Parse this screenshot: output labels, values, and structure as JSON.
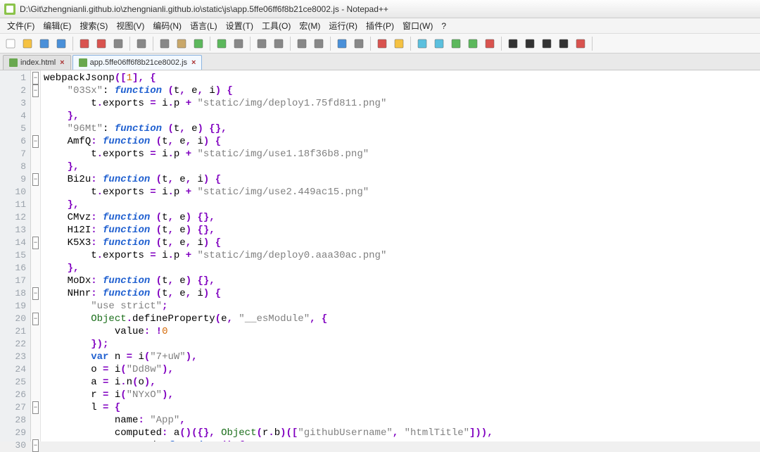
{
  "window": {
    "title": "D:\\Git\\zhengnianli.github.io\\zhengnianli.github.io\\static\\js\\app.5ffe06ff6f8b21ce8002.js - Notepad++"
  },
  "menu": {
    "items": [
      "文件(F)",
      "编辑(E)",
      "搜索(S)",
      "视图(V)",
      "编码(N)",
      "语言(L)",
      "设置(T)",
      "工具(O)",
      "宏(M)",
      "运行(R)",
      "插件(P)",
      "窗口(W)",
      "?"
    ]
  },
  "toolbar": {
    "buttons": [
      "new",
      "open",
      "save",
      "save-all",
      "close",
      "close-all",
      "print",
      "cut",
      "copy",
      "paste",
      "undo",
      "redo",
      "find",
      "replace",
      "zoom-in",
      "zoom-out",
      "sync",
      "wrap",
      "hidden",
      "indent",
      "folder",
      "doc",
      "func",
      "comment",
      "comment2",
      "rec",
      "play",
      "play-fast",
      "play-list",
      "play-next",
      "spell"
    ]
  },
  "tabs": {
    "items": [
      {
        "label": "index.html",
        "active": false
      },
      {
        "label": "app.5ffe06ff6f8b21ce8002.js",
        "active": true
      }
    ]
  },
  "code": {
    "lines": [
      {
        "n": 1,
        "fold": "minus",
        "t": [
          [
            "id",
            "webpackJsonp"
          ],
          [
            "punc",
            "(["
          ],
          [
            "num",
            "1"
          ],
          [
            "punc",
            "], {"
          ]
        ]
      },
      {
        "n": 2,
        "fold": "minus",
        "t": [
          [
            "sp",
            "    "
          ],
          [
            "str",
            "\"03Sx\""
          ],
          [
            "id",
            ": "
          ],
          [
            "fn",
            "function"
          ],
          [
            "id",
            " "
          ],
          [
            "punc",
            "("
          ],
          [
            "id",
            "t"
          ],
          [
            "punc",
            ", "
          ],
          [
            "id",
            "e"
          ],
          [
            "punc",
            ", "
          ],
          [
            "id",
            "i"
          ],
          [
            "punc",
            ") {"
          ]
        ]
      },
      {
        "n": 3,
        "t": [
          [
            "sp",
            "        "
          ],
          [
            "id",
            "t"
          ],
          [
            "punc",
            "."
          ],
          [
            "id",
            "exports "
          ],
          [
            "punc",
            "= "
          ],
          [
            "id",
            "i"
          ],
          [
            "punc",
            "."
          ],
          [
            "id",
            "p "
          ],
          [
            "punc",
            "+ "
          ],
          [
            "str",
            "\"static/img/deploy1.75fd811.png\""
          ]
        ]
      },
      {
        "n": 4,
        "t": [
          [
            "sp",
            "    "
          ],
          [
            "punc",
            "},"
          ]
        ]
      },
      {
        "n": 5,
        "t": [
          [
            "sp",
            "    "
          ],
          [
            "str",
            "\"96Mt\""
          ],
          [
            "id",
            ": "
          ],
          [
            "fn",
            "function"
          ],
          [
            "id",
            " "
          ],
          [
            "punc",
            "("
          ],
          [
            "id",
            "t"
          ],
          [
            "punc",
            ", "
          ],
          [
            "id",
            "e"
          ],
          [
            "punc",
            ") {},"
          ]
        ]
      },
      {
        "n": 6,
        "fold": "minus",
        "t": [
          [
            "sp",
            "    "
          ],
          [
            "id",
            "AmfQ"
          ],
          [
            "punc",
            ": "
          ],
          [
            "fn",
            "function"
          ],
          [
            "id",
            " "
          ],
          [
            "punc",
            "("
          ],
          [
            "id",
            "t"
          ],
          [
            "punc",
            ", "
          ],
          [
            "id",
            "e"
          ],
          [
            "punc",
            ", "
          ],
          [
            "id",
            "i"
          ],
          [
            "punc",
            ") {"
          ]
        ]
      },
      {
        "n": 7,
        "t": [
          [
            "sp",
            "        "
          ],
          [
            "id",
            "t"
          ],
          [
            "punc",
            "."
          ],
          [
            "id",
            "exports "
          ],
          [
            "punc",
            "= "
          ],
          [
            "id",
            "i"
          ],
          [
            "punc",
            "."
          ],
          [
            "id",
            "p "
          ],
          [
            "punc",
            "+ "
          ],
          [
            "str",
            "\"static/img/use1.18f36b8.png\""
          ]
        ]
      },
      {
        "n": 8,
        "t": [
          [
            "sp",
            "    "
          ],
          [
            "punc",
            "},"
          ]
        ]
      },
      {
        "n": 9,
        "fold": "minus",
        "t": [
          [
            "sp",
            "    "
          ],
          [
            "id",
            "Bi2u"
          ],
          [
            "punc",
            ": "
          ],
          [
            "fn",
            "function"
          ],
          [
            "id",
            " "
          ],
          [
            "punc",
            "("
          ],
          [
            "id",
            "t"
          ],
          [
            "punc",
            ", "
          ],
          [
            "id",
            "e"
          ],
          [
            "punc",
            ", "
          ],
          [
            "id",
            "i"
          ],
          [
            "punc",
            ") {"
          ]
        ]
      },
      {
        "n": 10,
        "t": [
          [
            "sp",
            "        "
          ],
          [
            "id",
            "t"
          ],
          [
            "punc",
            "."
          ],
          [
            "id",
            "exports "
          ],
          [
            "punc",
            "= "
          ],
          [
            "id",
            "i"
          ],
          [
            "punc",
            "."
          ],
          [
            "id",
            "p "
          ],
          [
            "punc",
            "+ "
          ],
          [
            "str",
            "\"static/img/use2.449ac15.png\""
          ]
        ]
      },
      {
        "n": 11,
        "t": [
          [
            "sp",
            "    "
          ],
          [
            "punc",
            "},"
          ]
        ]
      },
      {
        "n": 12,
        "t": [
          [
            "sp",
            "    "
          ],
          [
            "id",
            "CMvz"
          ],
          [
            "punc",
            ": "
          ],
          [
            "fn",
            "function"
          ],
          [
            "id",
            " "
          ],
          [
            "punc",
            "("
          ],
          [
            "id",
            "t"
          ],
          [
            "punc",
            ", "
          ],
          [
            "id",
            "e"
          ],
          [
            "punc",
            ") {},"
          ]
        ]
      },
      {
        "n": 13,
        "t": [
          [
            "sp",
            "    "
          ],
          [
            "id",
            "H12I"
          ],
          [
            "punc",
            ": "
          ],
          [
            "fn",
            "function"
          ],
          [
            "id",
            " "
          ],
          [
            "punc",
            "("
          ],
          [
            "id",
            "t"
          ],
          [
            "punc",
            ", "
          ],
          [
            "id",
            "e"
          ],
          [
            "punc",
            ") {},"
          ]
        ]
      },
      {
        "n": 14,
        "fold": "minus",
        "t": [
          [
            "sp",
            "    "
          ],
          [
            "id",
            "K5X3"
          ],
          [
            "punc",
            ": "
          ],
          [
            "fn",
            "function"
          ],
          [
            "id",
            " "
          ],
          [
            "punc",
            "("
          ],
          [
            "id",
            "t"
          ],
          [
            "punc",
            ", "
          ],
          [
            "id",
            "e"
          ],
          [
            "punc",
            ", "
          ],
          [
            "id",
            "i"
          ],
          [
            "punc",
            ") {"
          ]
        ]
      },
      {
        "n": 15,
        "t": [
          [
            "sp",
            "        "
          ],
          [
            "id",
            "t"
          ],
          [
            "punc",
            "."
          ],
          [
            "id",
            "exports "
          ],
          [
            "punc",
            "= "
          ],
          [
            "id",
            "i"
          ],
          [
            "punc",
            "."
          ],
          [
            "id",
            "p "
          ],
          [
            "punc",
            "+ "
          ],
          [
            "str",
            "\"static/img/deploy0.aaa30ac.png\""
          ]
        ]
      },
      {
        "n": 16,
        "t": [
          [
            "sp",
            "    "
          ],
          [
            "punc",
            "},"
          ]
        ]
      },
      {
        "n": 17,
        "t": [
          [
            "sp",
            "    "
          ],
          [
            "id",
            "MoDx"
          ],
          [
            "punc",
            ": "
          ],
          [
            "fn",
            "function"
          ],
          [
            "id",
            " "
          ],
          [
            "punc",
            "("
          ],
          [
            "id",
            "t"
          ],
          [
            "punc",
            ", "
          ],
          [
            "id",
            "e"
          ],
          [
            "punc",
            ") {},"
          ]
        ]
      },
      {
        "n": 18,
        "fold": "minus",
        "t": [
          [
            "sp",
            "    "
          ],
          [
            "id",
            "NHnr"
          ],
          [
            "punc",
            ": "
          ],
          [
            "fn",
            "function"
          ],
          [
            "id",
            " "
          ],
          [
            "punc",
            "("
          ],
          [
            "id",
            "t"
          ],
          [
            "punc",
            ", "
          ],
          [
            "id",
            "e"
          ],
          [
            "punc",
            ", "
          ],
          [
            "id",
            "i"
          ],
          [
            "punc",
            ") {"
          ]
        ]
      },
      {
        "n": 19,
        "t": [
          [
            "sp",
            "        "
          ],
          [
            "str",
            "\"use strict\""
          ],
          [
            "punc",
            ";"
          ]
        ]
      },
      {
        "n": 20,
        "fold": "minus",
        "t": [
          [
            "sp",
            "        "
          ],
          [
            "obj",
            "Object"
          ],
          [
            "punc",
            "."
          ],
          [
            "id",
            "defineProperty"
          ],
          [
            "punc",
            "("
          ],
          [
            "id",
            "e"
          ],
          [
            "punc",
            ", "
          ],
          [
            "str",
            "\"__esModule\""
          ],
          [
            "punc",
            ", {"
          ]
        ]
      },
      {
        "n": 21,
        "t": [
          [
            "sp",
            "            "
          ],
          [
            "id",
            "value"
          ],
          [
            "punc",
            ": !"
          ],
          [
            "num",
            "0"
          ]
        ]
      },
      {
        "n": 22,
        "t": [
          [
            "sp",
            "        "
          ],
          [
            "punc",
            "});"
          ]
        ]
      },
      {
        "n": 23,
        "t": [
          [
            "sp",
            "        "
          ],
          [
            "kw",
            "var"
          ],
          [
            "id",
            " n "
          ],
          [
            "punc",
            "= "
          ],
          [
            "id",
            "i"
          ],
          [
            "punc",
            "("
          ],
          [
            "str",
            "\"7+uW\""
          ],
          [
            "punc",
            "),"
          ]
        ]
      },
      {
        "n": 24,
        "t": [
          [
            "sp",
            "        "
          ],
          [
            "id",
            "o "
          ],
          [
            "punc",
            "= "
          ],
          [
            "id",
            "i"
          ],
          [
            "punc",
            "("
          ],
          [
            "str",
            "\"Dd8w\""
          ],
          [
            "punc",
            "),"
          ]
        ]
      },
      {
        "n": 25,
        "t": [
          [
            "sp",
            "        "
          ],
          [
            "id",
            "a "
          ],
          [
            "punc",
            "= "
          ],
          [
            "id",
            "i"
          ],
          [
            "punc",
            "."
          ],
          [
            "id",
            "n"
          ],
          [
            "punc",
            "("
          ],
          [
            "id",
            "o"
          ],
          [
            "punc",
            "),"
          ]
        ]
      },
      {
        "n": 26,
        "t": [
          [
            "sp",
            "        "
          ],
          [
            "id",
            "r "
          ],
          [
            "punc",
            "= "
          ],
          [
            "id",
            "i"
          ],
          [
            "punc",
            "("
          ],
          [
            "str",
            "\"NYxO\""
          ],
          [
            "punc",
            "),"
          ]
        ]
      },
      {
        "n": 27,
        "fold": "minus",
        "t": [
          [
            "sp",
            "        "
          ],
          [
            "id",
            "l "
          ],
          [
            "punc",
            "= {"
          ]
        ]
      },
      {
        "n": 28,
        "t": [
          [
            "sp",
            "            "
          ],
          [
            "id",
            "name"
          ],
          [
            "punc",
            ": "
          ],
          [
            "str",
            "\"App\""
          ],
          [
            "punc",
            ","
          ]
        ]
      },
      {
        "n": 29,
        "t": [
          [
            "sp",
            "            "
          ],
          [
            "id",
            "computed"
          ],
          [
            "punc",
            ": "
          ],
          [
            "id",
            "a"
          ],
          [
            "punc",
            "()({}, "
          ],
          [
            "obj",
            "Object"
          ],
          [
            "punc",
            "("
          ],
          [
            "id",
            "r"
          ],
          [
            "punc",
            "."
          ],
          [
            "id",
            "b"
          ],
          [
            "punc",
            ")(["
          ],
          [
            "str",
            "\"githubUsername\""
          ],
          [
            "punc",
            ", "
          ],
          [
            "str",
            "\"htmlTitle\""
          ],
          [
            "punc",
            "])),"
          ]
        ]
      },
      {
        "n": 30,
        "fold": "minus",
        "t": [
          [
            "sp",
            "            "
          ],
          [
            "id",
            "created"
          ],
          [
            "punc",
            ": "
          ],
          [
            "fn",
            "function"
          ],
          [
            "id",
            " "
          ],
          [
            "punc",
            "() {"
          ]
        ]
      }
    ]
  }
}
